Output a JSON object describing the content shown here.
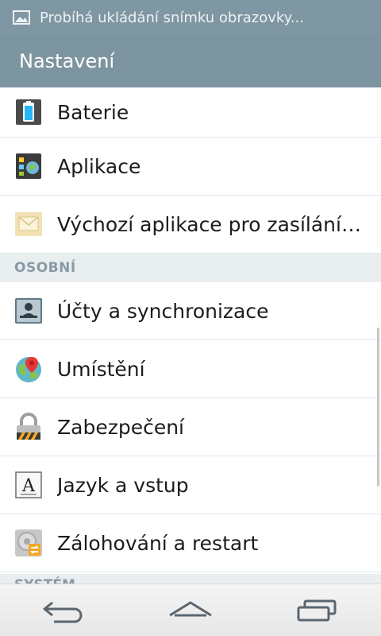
{
  "status_bar": {
    "notification_text": "Probíhá ukládání snímku obrazovky...",
    "icon": "image-icon"
  },
  "title_bar": {
    "title": "Nastavení"
  },
  "items_top": [
    {
      "label": "Baterie",
      "icon": "battery-icon"
    },
    {
      "label": "Aplikace",
      "icon": "apps-icon"
    },
    {
      "label": "Výchozí aplikace pro zasílání zpráv",
      "icon": "message-icon"
    }
  ],
  "section_personal": {
    "label": "OSOBNÍ"
  },
  "items_personal": [
    {
      "label": "Účty a synchronizace",
      "icon": "accounts-icon"
    },
    {
      "label": "Umístění",
      "icon": "location-icon"
    },
    {
      "label": "Zabezpečení",
      "icon": "lock-icon"
    },
    {
      "label": "Jazyk a vstup",
      "icon": "language-icon"
    },
    {
      "label": "Zálohování a restart",
      "icon": "backup-icon"
    }
  ],
  "section_system": {
    "label": "SYSTÉM"
  },
  "nav_bar": {
    "back": "back-icon",
    "home": "home-icon",
    "recents": "recents-icon"
  }
}
